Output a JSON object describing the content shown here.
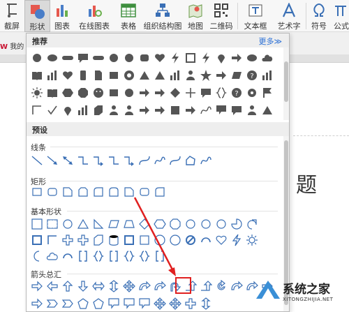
{
  "ribbon": {
    "screenshot_label": "截屏",
    "shape_label": "形状",
    "chart_label": "图表",
    "online_chart_label": "在线图表",
    "table_label": "表格",
    "org_chart_label": "组织结构图",
    "map_label": "地图",
    "qrcode_label": "二维码",
    "textbox_label": "文本框",
    "wordart_label": "艺术字",
    "symbol_label": "符号",
    "formula_label": "公式"
  },
  "doc": {
    "window_tab": "我的",
    "title_fragment": "题"
  },
  "panel": {
    "recommend_header": "推荐",
    "more_link": "更多≫",
    "preset_header": "预设",
    "groups": {
      "lines": "线条",
      "rectangles": "矩形",
      "basic_shapes": "基本形状",
      "block_arrows": "箭头总汇"
    }
  },
  "watermark": {
    "title": "系统之家",
    "url": "XITONGZHIJIA.NET"
  },
  "colors": {
    "accent": "#e02020",
    "icon_fill": "#555555",
    "outline_blue": "#3a6fb5",
    "link_blue": "#2a6fd6"
  }
}
